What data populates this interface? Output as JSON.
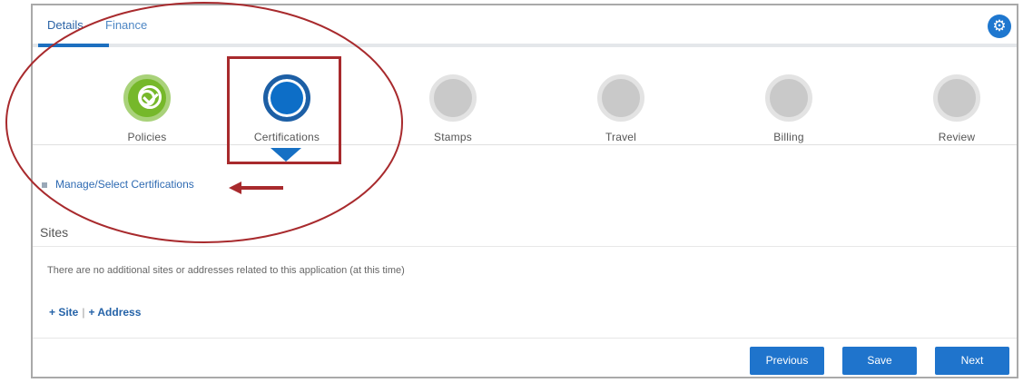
{
  "tabs": [
    {
      "label": "Details",
      "active": true
    },
    {
      "label": "Finance",
      "active": false
    }
  ],
  "settings_icon": "gear-icon",
  "steps": [
    {
      "label": "Policies",
      "state": "done"
    },
    {
      "label": "Certifications",
      "state": "active"
    },
    {
      "label": "Stamps",
      "state": "pending"
    },
    {
      "label": "Travel",
      "state": "pending"
    },
    {
      "label": "Billing",
      "state": "pending"
    },
    {
      "label": "Review",
      "state": "pending"
    }
  ],
  "manage_link": "Manage/Select Certifications",
  "sites": {
    "title": "Sites",
    "message": "There are no additional sites or addresses related to this application (at this time)",
    "add_site": "+ Site",
    "separator": "|",
    "add_address": "+ Address"
  },
  "buttons": {
    "previous": "Previous",
    "save": "Save",
    "next": "Next"
  },
  "colors": {
    "primary": "#1f74cc",
    "done": "#76b82a",
    "annotation": "#a82a2d"
  }
}
